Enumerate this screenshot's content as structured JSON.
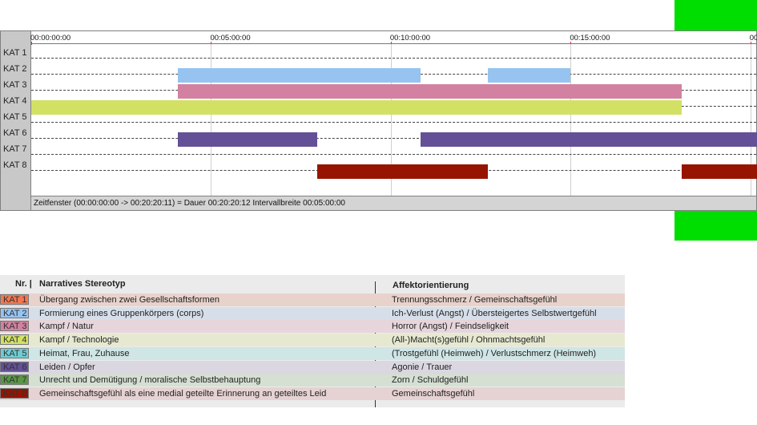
{
  "colors": {
    "green_marker": "#00dd00",
    "kat1": "#f07850",
    "kat2": "#96c3f0",
    "kat3": "#d282a0",
    "kat4": "#d2e164",
    "kat5": "#6ecdd2",
    "kat6": "#645096",
    "kat7": "#5a9646",
    "kat8": "#961400"
  },
  "timeline": {
    "total_seconds": 1211,
    "ticks": [
      {
        "label": "00:00:00:00",
        "seconds": 0
      },
      {
        "label": "00:05:00:00",
        "seconds": 300
      },
      {
        "label": "00:10:00:00",
        "seconds": 600
      },
      {
        "label": "00:15:00:00",
        "seconds": 900
      },
      {
        "label": "00:",
        "seconds": 1200
      }
    ],
    "rows": [
      {
        "label": "KAT 1",
        "segments": []
      },
      {
        "label": "KAT 2",
        "color": "kat2",
        "segments": [
          [
            244,
            650
          ],
          [
            762,
            900
          ]
        ]
      },
      {
        "label": "KAT 3",
        "color": "kat3",
        "segments": [
          [
            244,
            1085
          ]
        ]
      },
      {
        "label": "KAT 4",
        "color": "kat4",
        "segments": [
          [
            0,
            1085
          ]
        ]
      },
      {
        "label": "KAT 5",
        "segments": []
      },
      {
        "label": "KAT 6",
        "color": "kat6",
        "segments": [
          [
            244,
            477
          ],
          [
            650,
            1211
          ]
        ]
      },
      {
        "label": "KAT 7",
        "segments": []
      },
      {
        "label": "KAT 8",
        "color": "kat8",
        "segments": [
          [
            477,
            762
          ],
          [
            1085,
            1211
          ]
        ]
      }
    ],
    "footer_text": "Zeitfenster (00:00:00:00 -> 00:20:20:11) = Dauer 00:20:20:12    Intervallbreite 00:05:00:00"
  },
  "legend": {
    "col_nr": "Nr. |",
    "col_stereotype": "Narratives Stereotyp",
    "col_affect": "Affektorientierung",
    "rows": [
      {
        "code": "KAT 1",
        "color": "kat1",
        "bg": "#e8d2cc",
        "stereotype": "Übergang zwischen zwei Gesellschaftsformen",
        "affect": "Trennungsschmerz / Gemeinschaftsgefühl"
      },
      {
        "code": "KAT 2",
        "color": "kat2",
        "bg": "#d6dfe9",
        "stereotype": "Formierung eines Gruppenkörpers (corps)",
        "affect": "Ich-Verlust (Angst) / Übersteigertes Selbstwertgefühl"
      },
      {
        "code": "KAT 3",
        "color": "kat3",
        "bg": "#e6d6dc",
        "stereotype": "Kampf / Natur",
        "affect": "Horror (Angst) / Feindseligkeit"
      },
      {
        "code": "KAT 4",
        "color": "kat4",
        "bg": "#e6e9d0",
        "stereotype": "Kampf / Technologie",
        "affect": "(All-)Macht(s)gefühl / Ohnmachtsgefühl"
      },
      {
        "code": "KAT 5",
        "color": "kat5",
        "bg": "#d0e5e5",
        "stereotype": "Heimat, Frau, Zuhause",
        "affect": "(Trostgefühl (Heimweh) / Verlustschmerz (Heimweh)"
      },
      {
        "code": "KAT 6",
        "color": "kat6",
        "bg": "#dad7e1",
        "stereotype": "Leiden / Opfer",
        "affect": "Agonie / Trauer"
      },
      {
        "code": "KAT 7",
        "color": "kat7",
        "bg": "#d5dfd2",
        "stereotype": "Unrecht und Demütigung / moralische Selbstbehauptung",
        "affect": "Zorn / Schuldgefühl"
      },
      {
        "code": "KAT 8",
        "color": "kat8",
        "bg": "#e6d2d2",
        "stereotype": "Gemeinschaftsgefühl als eine medial geteilte Erinnerung an geteiltes Leid",
        "affect": "Gemeinschaftsgefühl"
      }
    ]
  }
}
